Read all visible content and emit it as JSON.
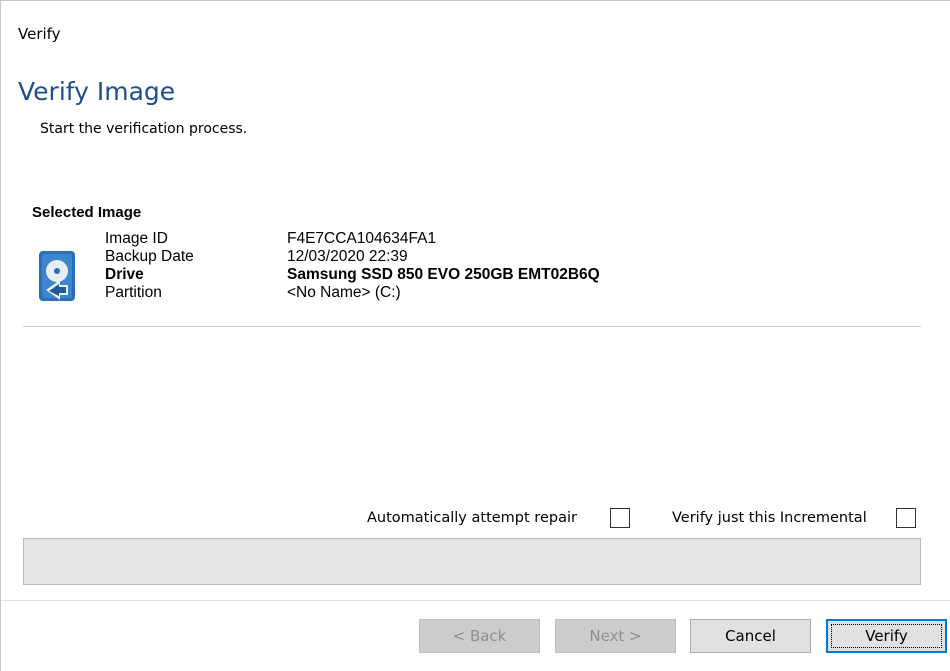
{
  "window": {
    "title": "Verify"
  },
  "header": {
    "title": "Verify Image",
    "subtitle": "Start the verification process."
  },
  "selected_image": {
    "heading": "Selected Image",
    "icon": "disk-image-icon",
    "rows": [
      {
        "label": "Image ID",
        "value": "F4E7CCA104634FA1"
      },
      {
        "label": "Backup Date",
        "value": "12/03/2020 22:39"
      },
      {
        "label": "Drive",
        "value": "Samsung SSD 850 EVO 250GB EMT02B6Q"
      },
      {
        "label": "Partition",
        "value": "<No Name> (C:)"
      }
    ]
  },
  "options": {
    "auto_repair": {
      "label": "Automatically attempt repair",
      "checked": false
    },
    "incremental": {
      "label": "Verify just this Incremental",
      "checked": false
    }
  },
  "progress": {
    "percent": 0
  },
  "footer": {
    "back_label": "< Back",
    "next_label": "Next >",
    "cancel_label": "Cancel",
    "verify_label": "Verify"
  },
  "colors": {
    "accent": "#1f4e8c",
    "focus": "#0078d7"
  }
}
